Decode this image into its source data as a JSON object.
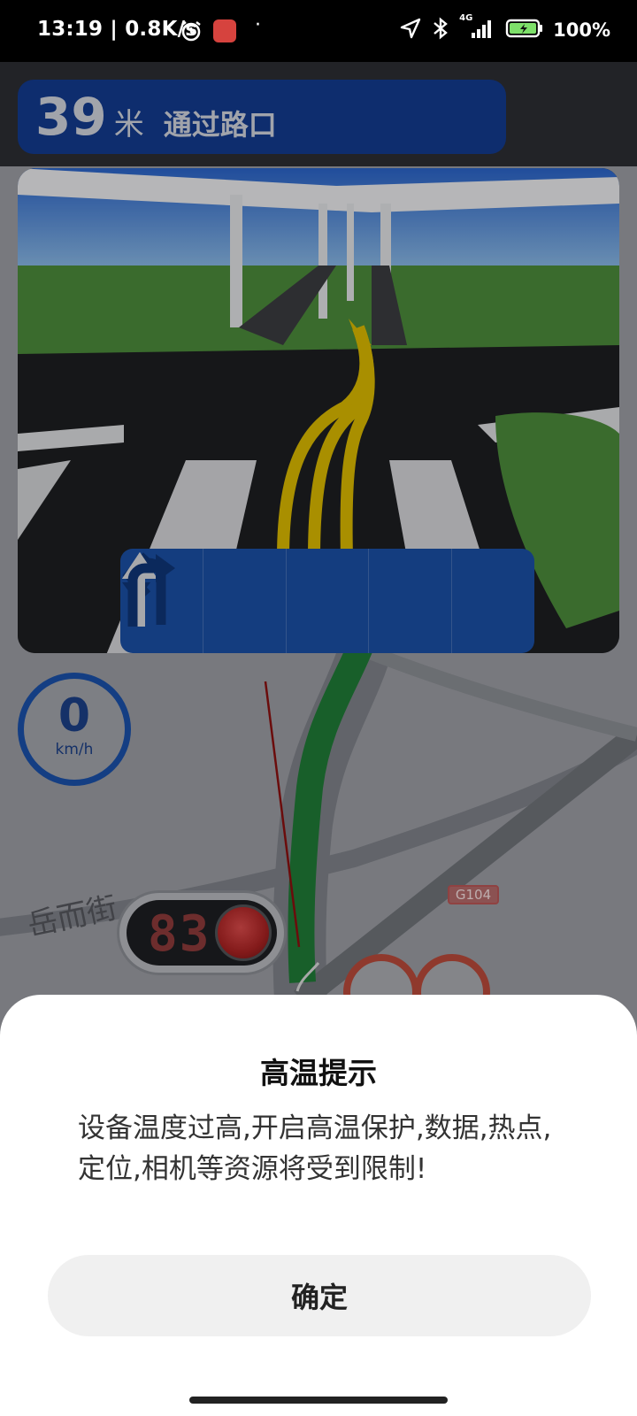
{
  "status_bar": {
    "time_speed": "13:19 | 0.8K/s",
    "dot": "·",
    "network": "4G",
    "battery": "100%"
  },
  "nav": {
    "distance": "39",
    "distance_unit": "米",
    "action": "通过路口",
    "speed": "0",
    "speed_unit": "km/h",
    "light_countdown": "83",
    "road_badge": "G104",
    "street_label": "岳而街"
  },
  "dialog": {
    "title": "高温提示",
    "message": "设备温度过高,开启高温保护,数据,热点,定位,相机等资源将受到限制!",
    "confirm_label": "确定"
  },
  "colors": {
    "banner_blue": "#123a8e",
    "route_green": "#1f8a3c",
    "guide_yellow": "#d9b800",
    "light_red": "#c32a2a"
  }
}
